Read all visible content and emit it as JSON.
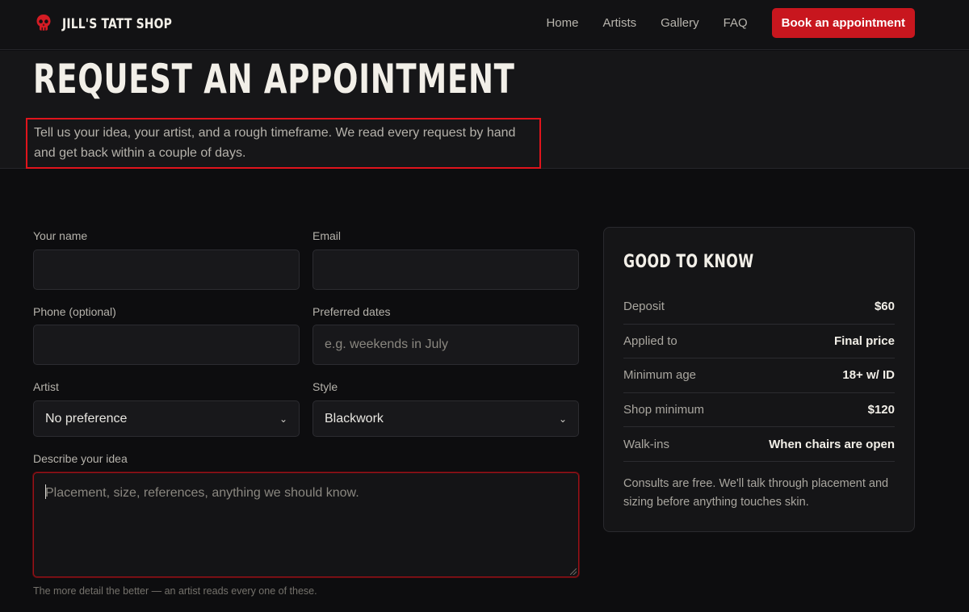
{
  "header": {
    "brand": "JILL'S TATT SHOP",
    "logo_icon": "skull-icon",
    "nav": [
      {
        "label": "Home"
      },
      {
        "label": "Artists"
      },
      {
        "label": "Gallery"
      },
      {
        "label": "FAQ"
      }
    ],
    "cta_label": "Book an appointment"
  },
  "hero": {
    "title": "REQUEST AN APPOINTMENT",
    "lead": "Tell us your idea, your artist, and a rough timeframe. We read every request by hand and get back within a couple of days."
  },
  "form": {
    "name_label": "Your name",
    "name_value": "",
    "email_label": "Email",
    "email_value": "",
    "phone_label": "Phone (optional)",
    "phone_value": "",
    "dates_label": "Preferred dates",
    "dates_placeholder": "e.g. weekends in July",
    "artist_label": "Artist",
    "artist_value": "No preference",
    "style_label": "Style",
    "style_value": "Blackwork",
    "idea_label": "Describe your idea",
    "idea_placeholder": "Placement, size, references, anything we should know.",
    "idea_help": "The more detail the better — an artist reads every one of these."
  },
  "info": {
    "title": "GOOD TO KNOW",
    "rows": [
      {
        "key": "Deposit",
        "value": "$60"
      },
      {
        "key": "Applied to",
        "value": "Final price"
      },
      {
        "key": "Minimum age",
        "value": "18+ w/ ID"
      },
      {
        "key": "Shop minimum",
        "value": "$120"
      },
      {
        "key": "Walk-ins",
        "value": "When chairs are open"
      }
    ],
    "note": "Consults are free. We'll talk through placement and sizing before anything touches skin."
  },
  "colors": {
    "accent": "#c8161e",
    "background": "#0d0d0f",
    "highlight_outline": "#e0141c"
  }
}
